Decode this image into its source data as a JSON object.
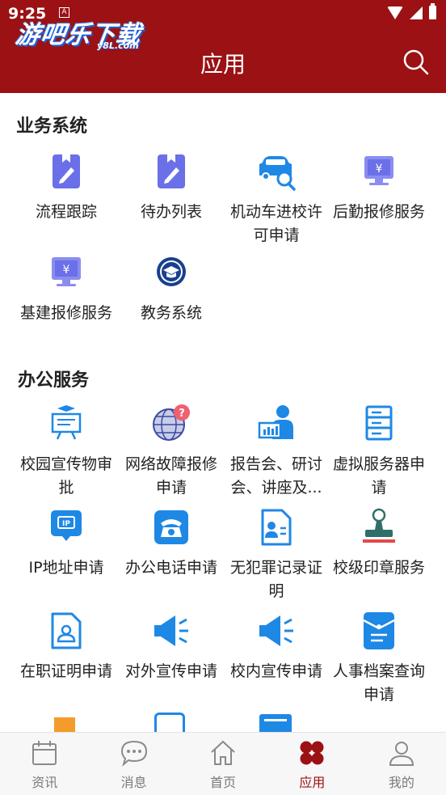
{
  "status_bar": {
    "time": "9:25",
    "notification": "A"
  },
  "logo": {
    "text": "游吧乐下载",
    "sub": "y8L.com"
  },
  "header": {
    "title": "应用"
  },
  "sections": [
    {
      "title": "业务系统",
      "items": [
        {
          "label": "流程跟踪",
          "icon": "pencil-doc-icon"
        },
        {
          "label": "待办列表",
          "icon": "pencil-doc-icon"
        },
        {
          "label": "机动车进校许可申请",
          "icon": "car-search-icon"
        },
        {
          "label": "后勤报修服务",
          "icon": "monitor-yen-icon"
        },
        {
          "label": "基建报修服务",
          "icon": "monitor-yen-icon"
        },
        {
          "label": "教务系统",
          "icon": "graduation-badge-icon"
        }
      ]
    },
    {
      "title": "办公服务",
      "items": [
        {
          "label": "校园宣传物审批",
          "icon": "presentation-board-icon"
        },
        {
          "label": "网络故障报修申请",
          "icon": "globe-question-icon"
        },
        {
          "label": "报告会、研讨会、讲座及...",
          "icon": "lecture-presenter-icon"
        },
        {
          "label": "虚拟服务器申请",
          "icon": "server-icon"
        },
        {
          "label": "IP地址申请",
          "icon": "ip-monitor-icon"
        },
        {
          "label": "办公电话申请",
          "icon": "telephone-icon"
        },
        {
          "label": "无犯罪记录证明",
          "icon": "certificate-doc-icon"
        },
        {
          "label": "校级印章服务",
          "icon": "stamp-icon"
        },
        {
          "label": "在职证明申请",
          "icon": "employee-doc-icon"
        },
        {
          "label": "对外宣传申请",
          "icon": "megaphone-icon"
        },
        {
          "label": "校内宣传申请",
          "icon": "megaphone-icon"
        },
        {
          "label": "人事档案查询申请",
          "icon": "archive-folder-icon"
        }
      ]
    }
  ],
  "tabbar": [
    {
      "label": "资讯",
      "icon": "calendar-icon"
    },
    {
      "label": "消息",
      "icon": "chat-bubble-icon"
    },
    {
      "label": "首页",
      "icon": "home-icon"
    },
    {
      "label": "应用",
      "icon": "apps-grid-icon",
      "active": true
    },
    {
      "label": "我的",
      "icon": "person-icon"
    }
  ],
  "colors": {
    "primary": "#9b1114",
    "icon_blue": "#1e88e5",
    "icon_purple": "#6b6fe8"
  }
}
